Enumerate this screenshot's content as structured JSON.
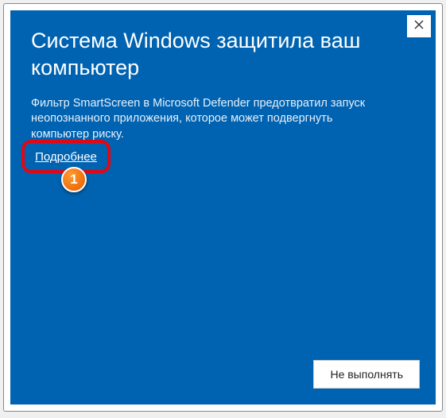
{
  "dialog": {
    "title": "Система Windows защитила ваш компьютер",
    "description": "Фильтр SmartScreen в Microsoft Defender предотвратил запуск неопознанного приложения, которое может подвергнуть компьютер риску.",
    "more_info_link": "Подробнее",
    "dont_run_button": "Не выполнять"
  },
  "annotation": {
    "step_number": "1"
  },
  "colors": {
    "dialog_bg": "#0063b1",
    "highlight_border": "#e30613",
    "badge_fill": "#e65c00"
  }
}
